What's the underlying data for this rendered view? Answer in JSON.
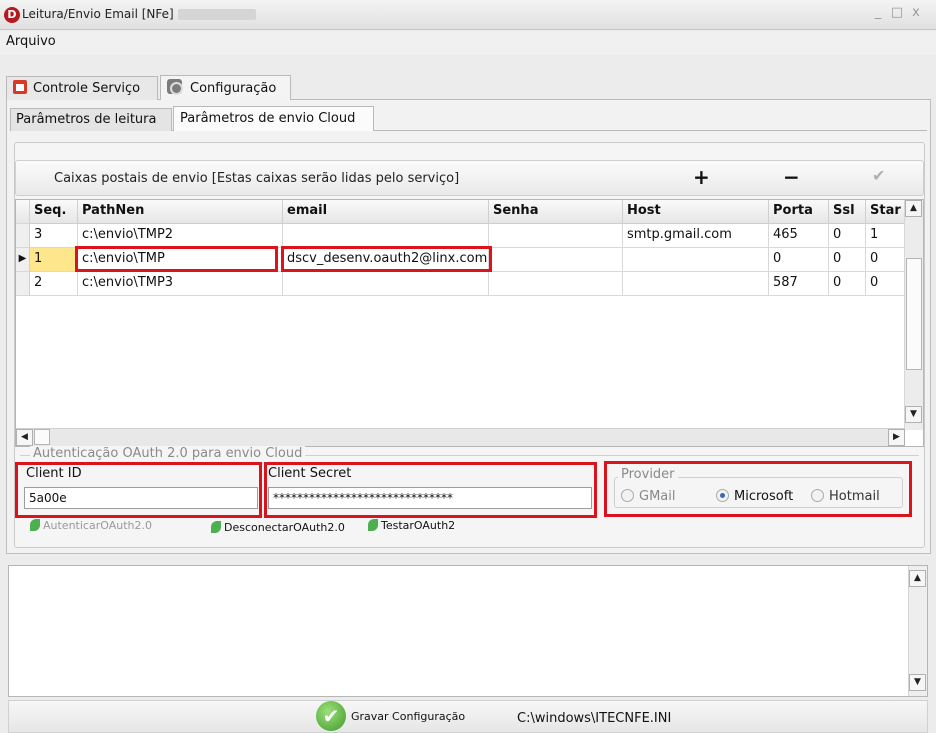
{
  "window": {
    "title": "Leitura/Envio Email [NFe] -",
    "app_icon": "D",
    "controls": {
      "minimize": "_",
      "maximize": "□",
      "close": "x"
    }
  },
  "menu": {
    "items": [
      "Arquivo"
    ]
  },
  "main_tabs": [
    {
      "label": "Controle Serviço",
      "icon": "house-icon"
    },
    {
      "label": "Configuração",
      "icon": "gear-icon",
      "active": true
    }
  ],
  "sub_tabs": [
    {
      "label": "Parâmetros de leitura"
    },
    {
      "label": "Parâmetros de envio Cloud",
      "active": true
    }
  ],
  "mailboxes": {
    "toolbar_label": "Caixas postais de envio [Estas caixas serão lidas pelo serviço]",
    "add_label": "+",
    "remove_label": "−",
    "confirm_label": "✔",
    "columns": [
      "Seq.",
      "PathNen",
      "email",
      "Senha",
      "Host",
      "Porta",
      "Ssl",
      "Star"
    ],
    "rows": [
      {
        "seq": "3",
        "path": "c:\\envio\\TMP2",
        "email": "",
        "senha": "",
        "host": "smtp.gmail.com",
        "porta": "465",
        "ssl": "0",
        "star": "1"
      },
      {
        "seq": "1",
        "path": "c:\\envio\\TMP",
        "email": "dscv_desenv.oauth2@linx.com",
        "senha": "",
        "host": "",
        "porta": "0",
        "ssl": "0",
        "star": "0"
      },
      {
        "seq": "2",
        "path": "c:\\envio\\TMP3",
        "email": "",
        "senha": "",
        "host": "",
        "porta": "587",
        "ssl": "0",
        "star": "0"
      }
    ]
  },
  "oauth": {
    "legend": "Autenticação OAuth 2.0 para envio Cloud",
    "client_id_label": "Client ID",
    "client_id_value": "5a00e",
    "client_secret_label": "Client Secret",
    "client_secret_value": "******************************",
    "provider_label": "Provider",
    "providers": [
      {
        "label": "GMail",
        "selected": false
      },
      {
        "label": "Microsoft",
        "selected": true
      },
      {
        "label": "Hotmail",
        "selected": false
      }
    ],
    "actions": [
      "AutenticarOAuth2.0",
      "DesconectarOAuth2.0",
      "TestarOAuth2"
    ]
  },
  "footer": {
    "save_label": "Gravar Configuração",
    "ini_path": "C:\\windows\\ITECNFE.INI"
  },
  "colors": {
    "highlight": "#d9141c",
    "app_icon": "#b3191d",
    "save_green": "#3f9a2b"
  }
}
